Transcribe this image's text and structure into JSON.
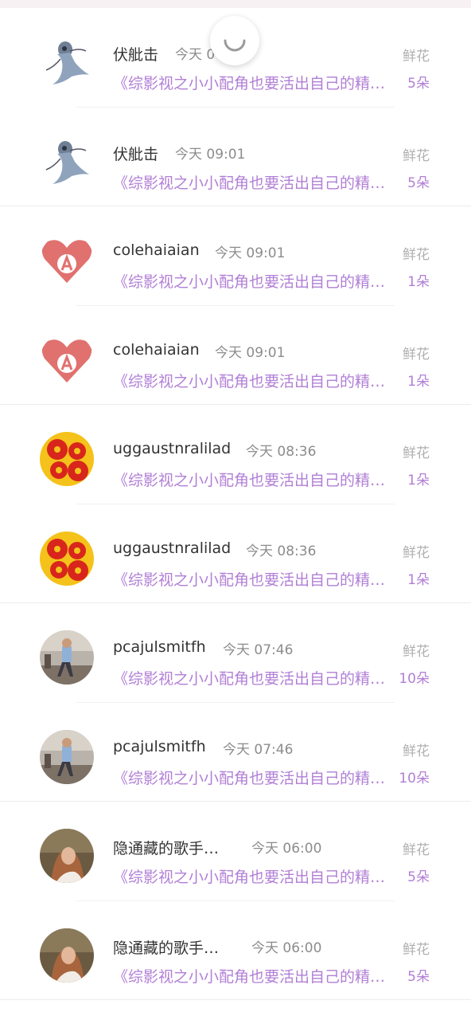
{
  "loading": {
    "icon": "loading-spinner-icon"
  },
  "items": [
    {
      "name": "伏舭击",
      "time": "今天 0",
      "book": "《综影视之小小配角也要活出自己的精彩》",
      "gift_label": "鲜花",
      "gift_count": "5朵",
      "avatar": "ghost-figure-avatar"
    },
    {
      "name": "伏舭击",
      "time": "今天 09:01",
      "book": "《综影视之小小配角也要活出自己的精彩》",
      "gift_label": "鲜花",
      "gift_count": "5朵",
      "avatar": "ghost-figure-avatar"
    },
    {
      "name": "colehaiaian",
      "time": "今天 09:01",
      "book": "《综影视之小小配角也要活出自己的精彩》",
      "gift_label": "鲜花",
      "gift_count": "1朵",
      "avatar": "heart-letter-a-avatar"
    },
    {
      "name": "colehaiaian",
      "time": "今天 09:01",
      "book": "《综影视之小小配角也要活出自己的精彩》",
      "gift_label": "鲜花",
      "gift_count": "1朵",
      "avatar": "heart-letter-a-avatar"
    },
    {
      "name": "uggaustnralilad",
      "time": "今天 08:36",
      "book": "《综影视之小小配角也要活出自己的精彩》",
      "gift_label": "鲜花",
      "gift_count": "1朵",
      "avatar": "red-flowers-avatar"
    },
    {
      "name": "uggaustnralilad",
      "time": "今天 08:36",
      "book": "《综影视之小小配角也要活出自己的精彩》",
      "gift_label": "鲜花",
      "gift_count": "1朵",
      "avatar": "red-flowers-avatar"
    },
    {
      "name": "pcajulsmitfh",
      "time": "今天 07:46",
      "book": "《综影视之小小配角也要活出自己的精彩》",
      "gift_label": "鲜花",
      "gift_count": "10朵",
      "avatar": "street-photo-avatar"
    },
    {
      "name": "pcajulsmitfh",
      "time": "今天 07:46",
      "book": "《综影视之小小配角也要活出自己的精彩》",
      "gift_label": "鲜花",
      "gift_count": "10朵",
      "avatar": "street-photo-avatar"
    },
    {
      "name": "隐通藏的歌手…",
      "time": "今天 06:00",
      "book": "《综影视之小小配角也要活出自己的精彩》",
      "gift_label": "鲜花",
      "gift_count": "5朵",
      "avatar": "girl-portrait-avatar"
    },
    {
      "name": "隐通藏的歌手…",
      "time": "今天 06:00",
      "book": "《综影视之小小配角也要活出自己的精彩》",
      "gift_label": "鲜花",
      "gift_count": "5朵",
      "avatar": "girl-portrait-avatar"
    }
  ]
}
